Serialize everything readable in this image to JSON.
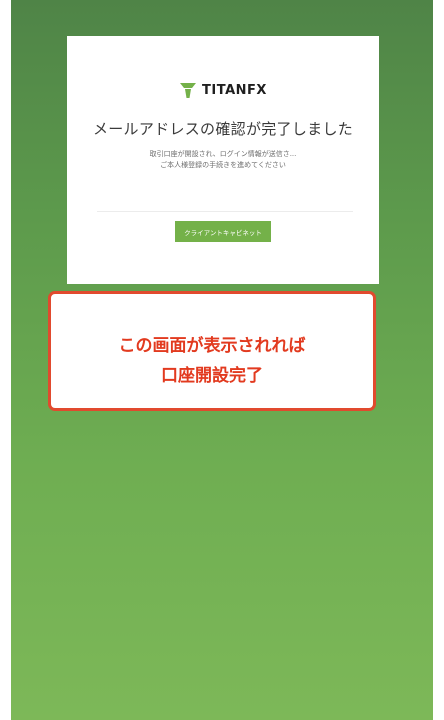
{
  "brand": {
    "logo_text": "TITANFX",
    "accent_color": "#74b149"
  },
  "card": {
    "headline": "メールアドレスの確認が完了しました",
    "description_line1": "取引口座が開設され、ログイン情報が送信さ...",
    "description_line2": "ご本人様登録の手続きを進めてください",
    "cta_label": "クライアントキャビネット"
  },
  "callout": {
    "line1": "この画面が表示されれば",
    "line2": "口座開設完了",
    "color": "#e23a1f"
  }
}
